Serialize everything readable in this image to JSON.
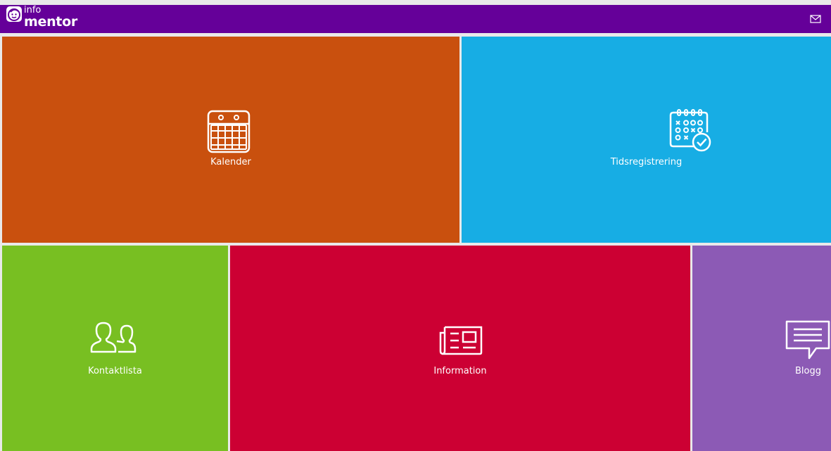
{
  "header": {
    "logo": {
      "top_text": "info",
      "bottom_text": "mentor"
    },
    "mail_icon": "mail-icon",
    "bar_color": "#650099"
  },
  "tiles": [
    {
      "label": "Kalender",
      "icon": "calendar-icon",
      "color": "#c9500e"
    },
    {
      "label": "Tidsregistrering",
      "icon": "time-registration-icon",
      "color": "#17ade4"
    },
    {
      "label": "Kontaktlista",
      "icon": "contacts-icon",
      "color": "#78bf22"
    },
    {
      "label": "Information",
      "icon": "newspaper-icon",
      "color": "#cc0033"
    },
    {
      "label": "Blogg",
      "icon": "speech-bubble-icon",
      "color": "#8c5ab5"
    }
  ]
}
